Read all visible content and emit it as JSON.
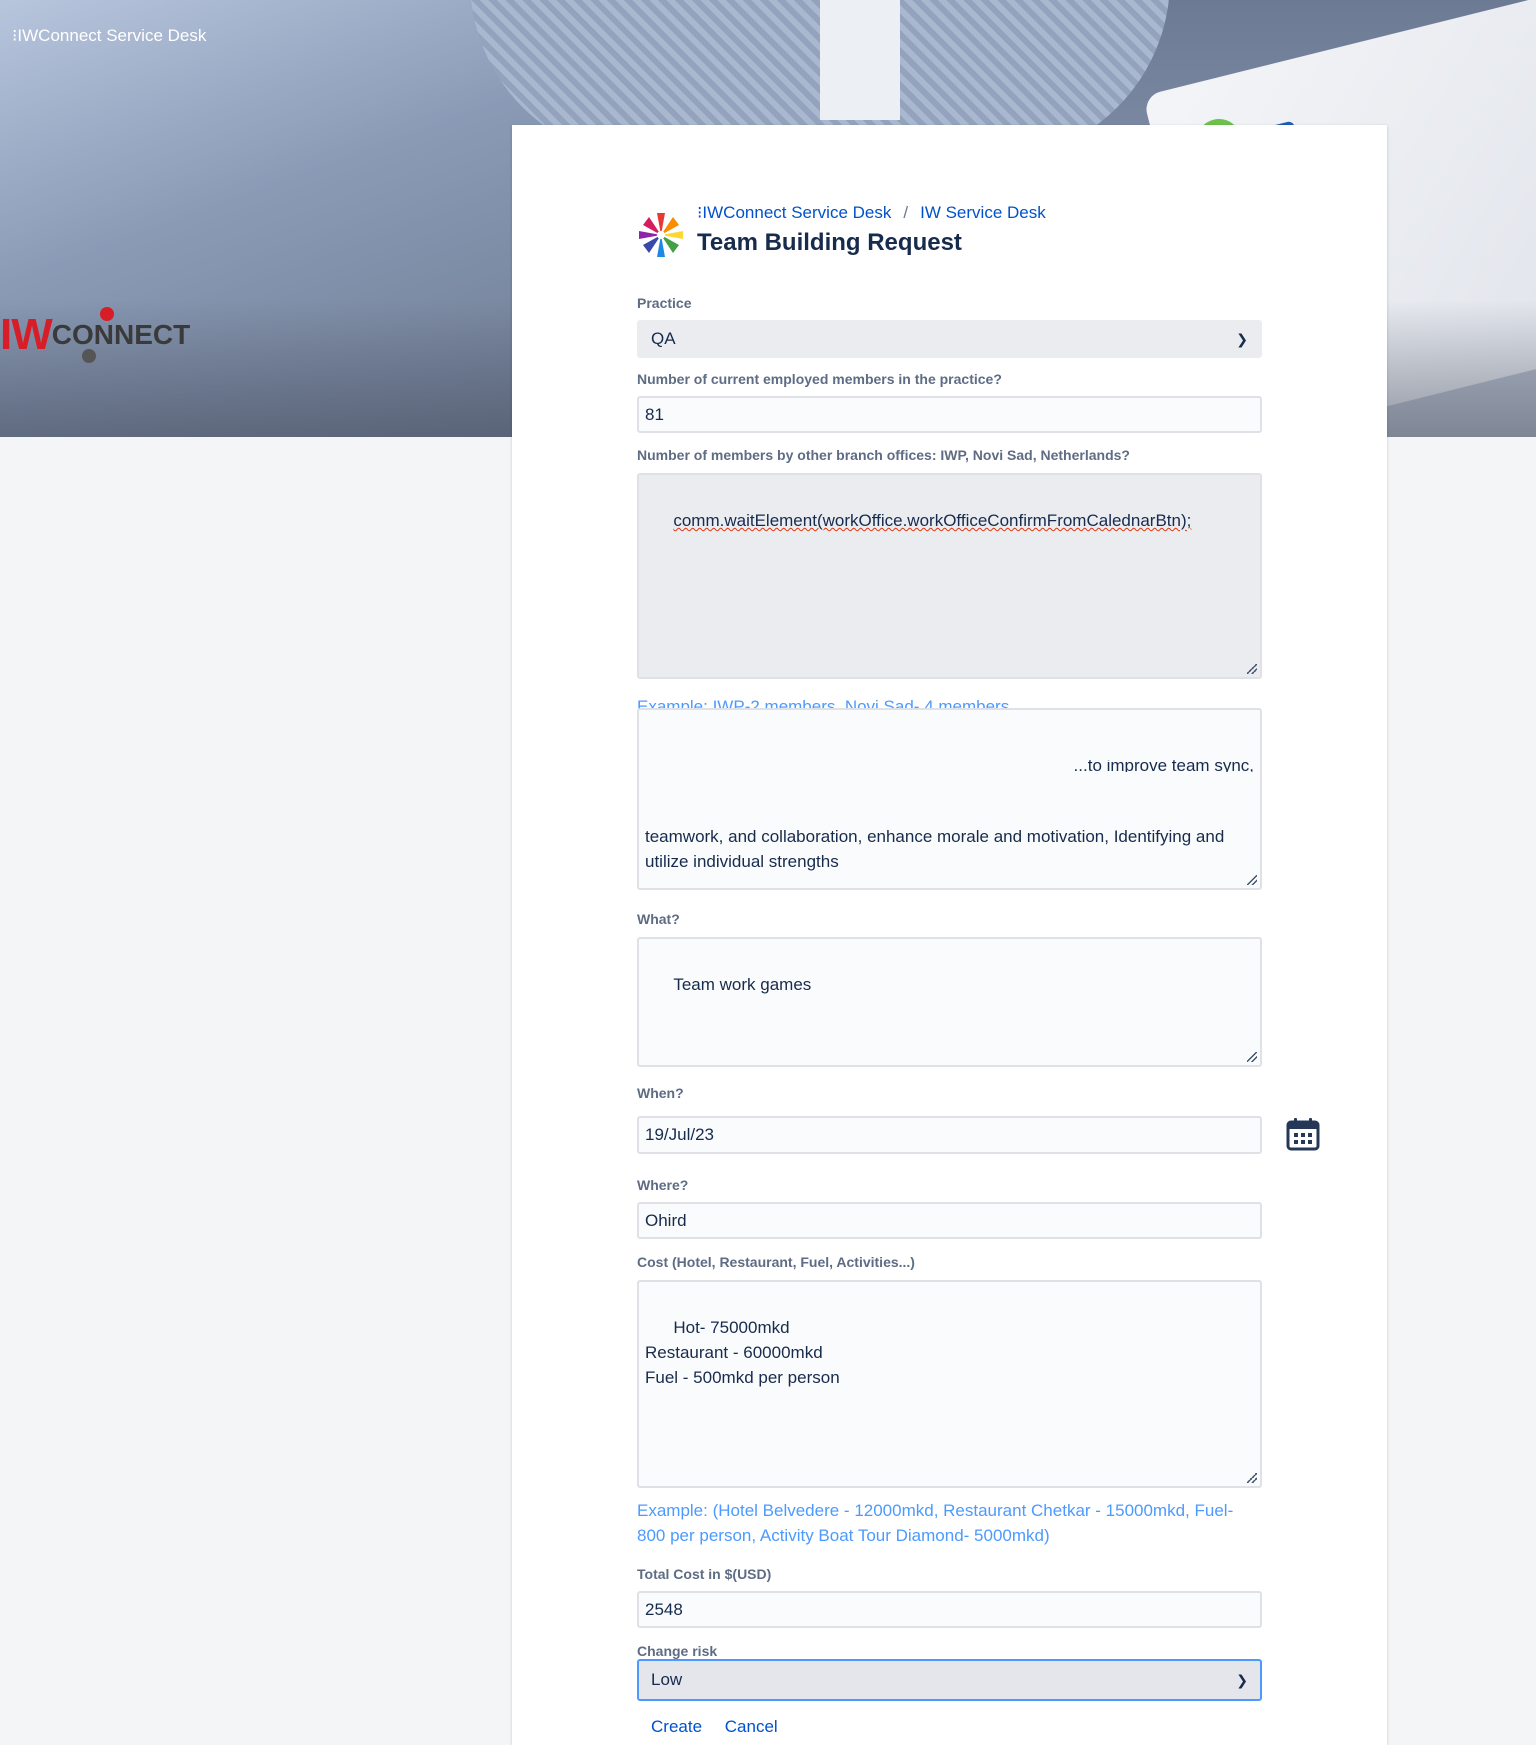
{
  "banner": {
    "brand": "⁝IWConnect Service Desk",
    "logo_iw": "IW",
    "logo_connect": "CONNECT"
  },
  "header": {
    "breadcrumb_1": "⁝IWConnect Service Desk",
    "breadcrumb_sep": "/",
    "breadcrumb_2": "IW Service Desk",
    "title": "Team Building Request"
  },
  "form": {
    "practice": {
      "label": "Practice",
      "value": "QA"
    },
    "members": {
      "label": "Number of current employed members in the practice?",
      "value": "81"
    },
    "branch": {
      "label": "Number of members by other branch offices: IWP, Novi Sad, Netherlands?",
      "value": "comm.waitElement(workOffice.workOfficeConfirmFromCalednarBtn);",
      "help": "Example: IWP-2 members, Novi Sad- 4 members..."
    },
    "why": {
      "overflow_line": "...to improve team sync,",
      "value": "teamwork, and collaboration, enhance morale and motivation, Identifying and utilize individual strengths"
    },
    "what": {
      "label": "What?",
      "value": "Team work games"
    },
    "when": {
      "label": "When?",
      "value": "19/Jul/23",
      "icon": "calendar-icon"
    },
    "where": {
      "label": "Where?",
      "value": "Ohird"
    },
    "cost": {
      "label": "Cost (Hotel, Restaurant, Fuel, Activities...)",
      "value": "Hot- 75000mkd\nRestaurant - 60000mkd\nFuel - 500mkd per person",
      "help": "Example: (Hotel Belvedere - 12000mkd, Restaurant Chetkar - 15000mkd, Fuel- 800 per person, Activity Boat Tour Diamond- 5000mkd)"
    },
    "total": {
      "label": "Total Cost in $(USD)",
      "value": "2548"
    },
    "risk": {
      "label": "Change risk",
      "value": "Low"
    },
    "actions": {
      "create": "Create",
      "cancel": "Cancel"
    }
  },
  "colors": {
    "link": "#0052cc",
    "help": "#4c9aff",
    "brand_red": "#d71e28",
    "focus": "#4c9aff"
  }
}
